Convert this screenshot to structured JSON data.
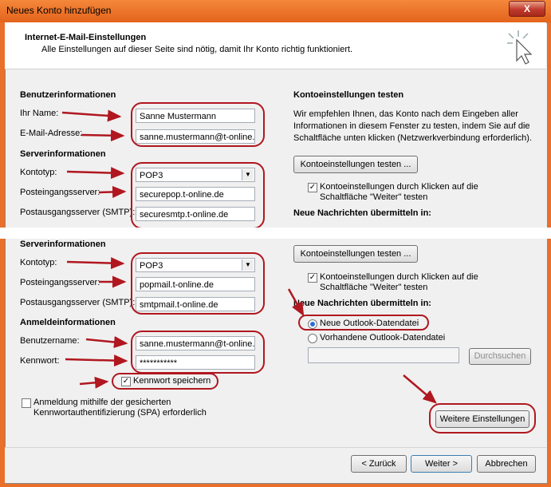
{
  "window": {
    "title": "Neues Konto hinzufügen",
    "close": "X"
  },
  "header": {
    "title": "Internet-E-Mail-Einstellungen",
    "subtitle": "Alle Einstellungen auf dieser Seite sind nötig, damit Ihr Konto richtig funktioniert."
  },
  "top": {
    "user_heading": "Benutzerinformationen",
    "name_label": "Ihr Name:",
    "name_value": "Sanne Mustermann",
    "email_label": "E-Mail-Adresse:",
    "email_value": "sanne.mustermann@t-online.d",
    "server_heading": "Serverinformationen",
    "type_label": "Kontotyp:",
    "type_value": "POP3",
    "incoming_label": "Posteingangsserver:",
    "incoming_value": "securepop.t-online.de",
    "outgoing_label": "Postausgangsserver (SMTP):",
    "outgoing_value": "securesmtp.t-online.de",
    "test_heading": "Kontoeinstellungen testen",
    "test_text": "Wir empfehlen Ihnen, das Konto nach dem Eingeben aller Informationen in diesem Fenster zu testen, indem Sie auf die Schaltfläche unten klicken (Netzwerkverbindung erforderlich).",
    "test_button": "Kontoeinstellungen testen ...",
    "test_checkbox": "Kontoeinstellungen durch Klicken auf die Schaltfläche \"Weiter\" testen",
    "deliver_heading": "Neue Nachrichten übermitteln in:"
  },
  "bottom": {
    "server_heading": "Serverinformationen",
    "type_label": "Kontotyp:",
    "type_value": "POP3",
    "incoming_label": "Posteingangsserver:",
    "incoming_value": "popmail.t-online.de",
    "outgoing_label": "Postausgangsserver (SMTP):",
    "outgoing_value": "smtpmail.t-online.de",
    "login_heading": "Anmeldeinformationen",
    "username_label": "Benutzername:",
    "username_value": "sanne.mustermann@t-online.d",
    "password_label": "Kennwort:",
    "password_value": "***********",
    "remember_label": "Kennwort speichern",
    "spa_label": "Anmeldung mithilfe der gesicherten Kennwortauthentifizierung (SPA) erforderlich",
    "test_button": "Kontoeinstellungen testen ...",
    "test_checkbox": "Kontoeinstellungen durch Klicken auf die Schaltfläche \"Weiter\" testen",
    "deliver_heading": "Neue Nachrichten übermitteln in:",
    "radio_new": "Neue Outlook-Datendatei",
    "radio_existing": "Vorhandene Outlook-Datendatei",
    "browse_button": "Durchsuchen",
    "more_settings_button": "Weitere Einstellungen"
  },
  "footer": {
    "back_button": "< Zurück",
    "next_button": "Weiter >",
    "cancel_button": "Abbrechen"
  },
  "colors": {
    "annotation_red": "#b0171f",
    "accent_orange": "#e8702a"
  }
}
